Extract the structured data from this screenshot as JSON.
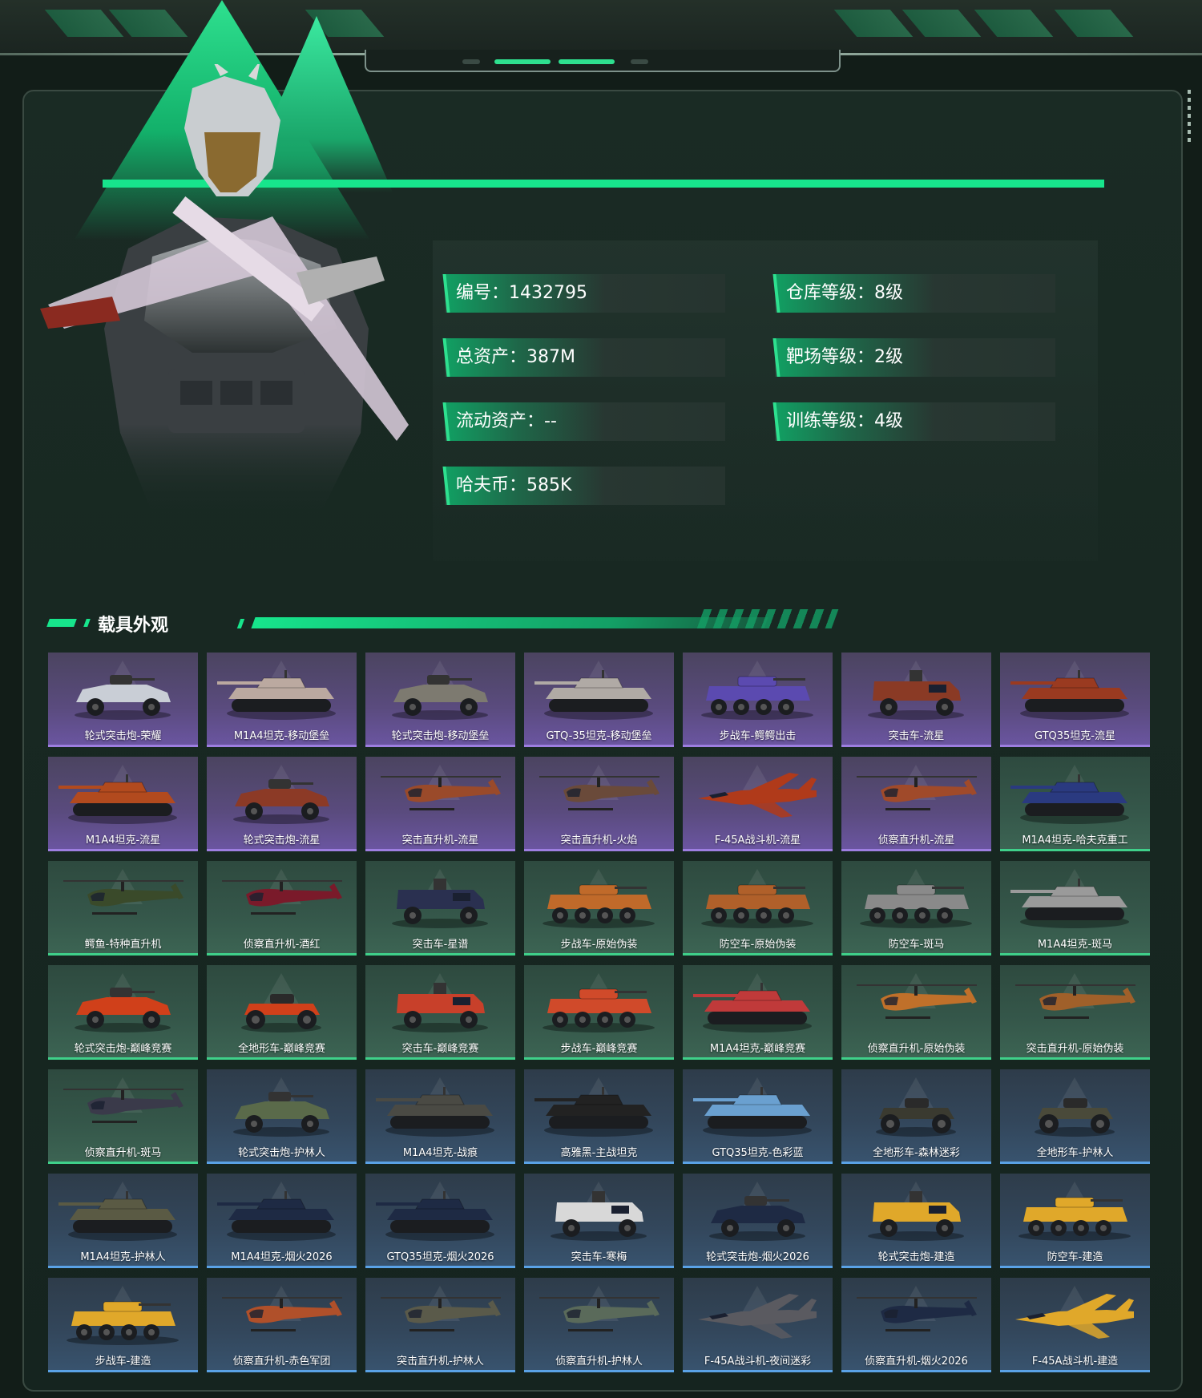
{
  "profile": {
    "stats": [
      {
        "label": "编号：1432795"
      },
      {
        "label": "仓库等级：8级"
      },
      {
        "label": "总资产：387M"
      },
      {
        "label": "靶场等级：2级"
      },
      {
        "label": "流动资产：--"
      },
      {
        "label": "训练等级：4级"
      },
      {
        "label": "哈夫币：585K"
      }
    ]
  },
  "section": {
    "title": "载具外观"
  },
  "colors": {
    "accent": "#17e58c",
    "purple_border": "#9d7ee0",
    "green_border": "#3fd08a",
    "blue_border": "#5aa2e6"
  },
  "vehicles": [
    {
      "name": "轮式突击炮-荣耀",
      "rarity": "purple",
      "kind": "car",
      "tint": "#c9ced6"
    },
    {
      "name": "M1A4坦克-移动堡垒",
      "rarity": "purple",
      "kind": "tank",
      "tint": "#bba9a0"
    },
    {
      "name": "轮式突击炮-移动堡垒",
      "rarity": "purple",
      "kind": "car",
      "tint": "#7d7a70"
    },
    {
      "name": "GTQ-35坦克-移动堡垒",
      "rarity": "purple",
      "kind": "tank",
      "tint": "#b0aaa5"
    },
    {
      "name": "步战车-鳄鳄出击",
      "rarity": "purple",
      "kind": "apc",
      "tint": "#5b4ab0"
    },
    {
      "name": "突击车-流星",
      "rarity": "purple",
      "kind": "truck",
      "tint": "#8a3a25"
    },
    {
      "name": "GTQ35坦克-流星",
      "rarity": "purple",
      "kind": "tank",
      "tint": "#9a3a20"
    },
    {
      "name": "M1A4坦克-流星",
      "rarity": "purple",
      "kind": "tank",
      "tint": "#b24a1e"
    },
    {
      "name": "轮式突击炮-流星",
      "rarity": "purple",
      "kind": "car",
      "tint": "#8c3a26"
    },
    {
      "name": "突击直升机-流星",
      "rarity": "purple",
      "kind": "heli",
      "tint": "#9a4a2a"
    },
    {
      "name": "突击直升机-火焰",
      "rarity": "purple",
      "kind": "heli",
      "tint": "#6a4a3a"
    },
    {
      "name": "F-45A战斗机-流星",
      "rarity": "purple",
      "kind": "jet",
      "tint": "#b03a1a"
    },
    {
      "name": "侦察直升机-流星",
      "rarity": "purple",
      "kind": "heli",
      "tint": "#a04a2a"
    },
    {
      "name": "M1A4坦克-哈夫克重工",
      "rarity": "green",
      "kind": "tank",
      "tint": "#2a3a80"
    },
    {
      "name": "鳄鱼-特种直升机",
      "rarity": "green",
      "kind": "heli",
      "tint": "#3a4a2a"
    },
    {
      "name": "侦察直升机-酒红",
      "rarity": "green",
      "kind": "heli",
      "tint": "#7a1a2a"
    },
    {
      "name": "突击车-星谱",
      "rarity": "green",
      "kind": "truck",
      "tint": "#2a3050"
    },
    {
      "name": "步战车-原始伪装",
      "rarity": "green",
      "kind": "apc",
      "tint": "#c06a2a"
    },
    {
      "name": "防空车-原始伪装",
      "rarity": "green",
      "kind": "apc",
      "tint": "#b0602a"
    },
    {
      "name": "防空车-斑马",
      "rarity": "green",
      "kind": "apc",
      "tint": "#8a8a8a"
    },
    {
      "name": "M1A4坦克-斑马",
      "rarity": "green",
      "kind": "tank",
      "tint": "#9a9a9a"
    },
    {
      "name": "轮式突击炮-巅峰竞赛",
      "rarity": "green",
      "kind": "car",
      "tint": "#d0401a"
    },
    {
      "name": "全地形车-巅峰竞赛",
      "rarity": "green",
      "kind": "atv",
      "tint": "#d0401a"
    },
    {
      "name": "突击车-巅峰竞赛",
      "rarity": "green",
      "kind": "truck",
      "tint": "#c8402a"
    },
    {
      "name": "步战车-巅峰竞赛",
      "rarity": "green",
      "kind": "apc",
      "tint": "#d04a2a"
    },
    {
      "name": "M1A4坦克-巅峰竞赛",
      "rarity": "green",
      "kind": "tank",
      "tint": "#c03a3a"
    },
    {
      "name": "侦察直升机-原始伪装",
      "rarity": "green",
      "kind": "heli",
      "tint": "#c0702a"
    },
    {
      "name": "突击直升机-原始伪装",
      "rarity": "green",
      "kind": "heli",
      "tint": "#a0602a"
    },
    {
      "name": "侦察直升机-斑马",
      "rarity": "green",
      "kind": "heli",
      "tint": "#3a3a4a"
    },
    {
      "name": "轮式突击炮-护林人",
      "rarity": "blue",
      "kind": "car",
      "tint": "#5a6a4a"
    },
    {
      "name": "M1A4坦克-战痕",
      "rarity": "blue",
      "kind": "tank",
      "tint": "#4a4a44"
    },
    {
      "name": "高雅黑-主战坦克",
      "rarity": "blue",
      "kind": "tank",
      "tint": "#222222"
    },
    {
      "name": "GTQ35坦克-色彩蓝",
      "rarity": "blue",
      "kind": "tank",
      "tint": "#6aa0d0"
    },
    {
      "name": "全地形车-森林迷彩",
      "rarity": "blue",
      "kind": "atv",
      "tint": "#3a3a30"
    },
    {
      "name": "全地形车-护林人",
      "rarity": "blue",
      "kind": "atv",
      "tint": "#4a4a3a"
    },
    {
      "name": "M1A4坦克-护林人",
      "rarity": "blue",
      "kind": "tank",
      "tint": "#5a5a44"
    },
    {
      "name": "M1A4坦克-烟火2026",
      "rarity": "blue",
      "kind": "tank",
      "tint": "#1e2a44"
    },
    {
      "name": "GTQ35坦克-烟火2026",
      "rarity": "blue",
      "kind": "tank",
      "tint": "#1e2a44"
    },
    {
      "name": "突击车-寒梅",
      "rarity": "blue",
      "kind": "truck",
      "tint": "#d8d8d8"
    },
    {
      "name": "轮式突击炮-烟火2026",
      "rarity": "blue",
      "kind": "car",
      "tint": "#1e2a44"
    },
    {
      "name": "轮式突击炮-建造",
      "rarity": "blue",
      "kind": "truck",
      "tint": "#e0a82a"
    },
    {
      "name": "防空车-建造",
      "rarity": "blue",
      "kind": "apc",
      "tint": "#e0a82a"
    },
    {
      "name": "步战车-建造",
      "rarity": "blue",
      "kind": "apc",
      "tint": "#e0a82a"
    },
    {
      "name": "侦察直升机-赤色军团",
      "rarity": "blue",
      "kind": "heli",
      "tint": "#b0502a"
    },
    {
      "name": "突击直升机-护林人",
      "rarity": "blue",
      "kind": "heli",
      "tint": "#5a5a4a"
    },
    {
      "name": "侦察直升机-护林人",
      "rarity": "blue",
      "kind": "heli",
      "tint": "#5a6a5a"
    },
    {
      "name": "F-45A战斗机-夜间迷彩",
      "rarity": "blue",
      "kind": "jet",
      "tint": "#5a5a60"
    },
    {
      "name": "侦察直升机-烟火2026",
      "rarity": "blue",
      "kind": "heli",
      "tint": "#1e2a44"
    },
    {
      "name": "F-45A战斗机-建造",
      "rarity": "blue",
      "kind": "jet",
      "tint": "#e0a82a"
    }
  ]
}
